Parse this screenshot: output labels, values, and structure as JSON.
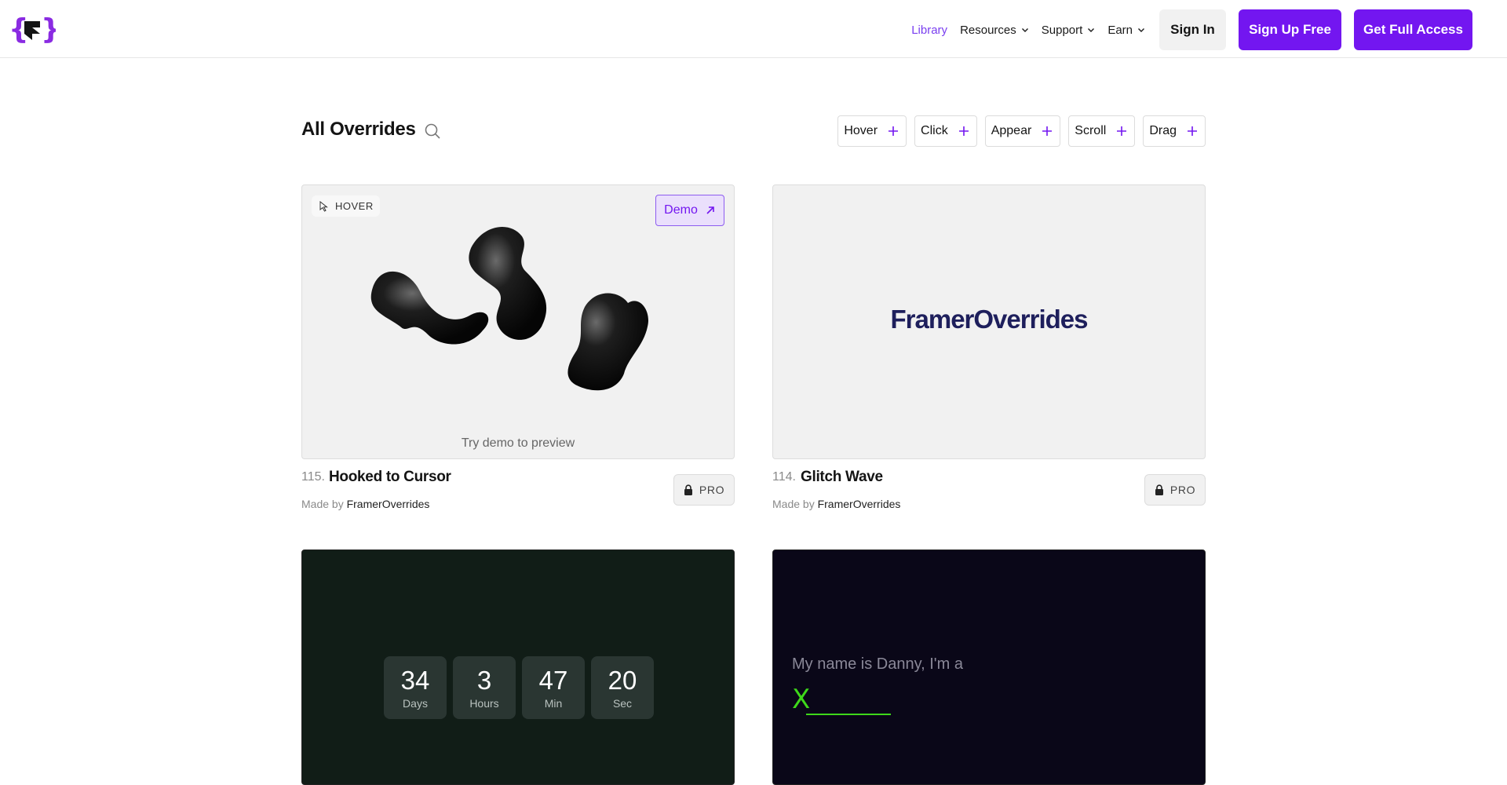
{
  "nav": {
    "library": "Library",
    "resources": "Resources",
    "support": "Support",
    "earn": "Earn",
    "sign_in": "Sign In",
    "sign_up": "Sign Up Free",
    "full_access": "Get Full Access"
  },
  "page": {
    "title": "All Overrides"
  },
  "filters": [
    "Hover",
    "Click",
    "Appear",
    "Scroll",
    "Drag"
  ],
  "cards": [
    {
      "number": "115.",
      "title": "Hooked to Cursor",
      "made_by_prefix": "Made by",
      "author": "FramerOverrides",
      "badge": "PRO",
      "trigger": "HOVER",
      "demo_label": "Demo",
      "preview_hint": "Try demo to preview"
    },
    {
      "number": "114.",
      "title": "Glitch Wave",
      "made_by_prefix": "Made by",
      "author": "FramerOverrides",
      "badge": "PRO",
      "wordmark": "FramerOverrides"
    }
  ],
  "countdown": [
    {
      "value": "34",
      "label": "Days"
    },
    {
      "value": "3",
      "label": "Hours"
    },
    {
      "value": "47",
      "label": "Min"
    },
    {
      "value": "20",
      "label": "Sec"
    }
  ],
  "typing": {
    "line": "My name is Danny, I'm a",
    "word": "X"
  },
  "colors": {
    "accent": "#7316f0",
    "wordmark": "#1e1f5c",
    "typing_green": "#3ed81a"
  }
}
